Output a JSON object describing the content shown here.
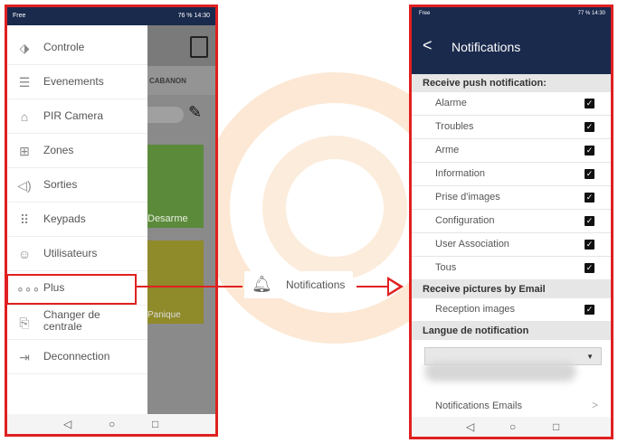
{
  "left": {
    "status": {
      "left": "Free",
      "right": "76 % 14:30"
    },
    "bg": {
      "tab": "CABANON",
      "green_label": "Desarme",
      "yellow_label": "Panique"
    },
    "menu": [
      {
        "name": "controle",
        "label": "Controle",
        "icon": "⬗"
      },
      {
        "name": "evenements",
        "label": "Evenements",
        "icon": "☰"
      },
      {
        "name": "pir-camera",
        "label": "PIR Camera",
        "icon": "⌂"
      },
      {
        "name": "zones",
        "label": "Zones",
        "icon": "⊞"
      },
      {
        "name": "sorties",
        "label": "Sorties",
        "icon": "◁)"
      },
      {
        "name": "keypads",
        "label": "Keypads",
        "icon": "⠿"
      },
      {
        "name": "utilisateurs",
        "label": "Utilisateurs",
        "icon": "☺"
      },
      {
        "name": "plus",
        "label": "Plus",
        "icon": "∘∘∘"
      },
      {
        "name": "changer-de-centrale",
        "label": "Changer de\ncentrale",
        "icon": "⎘"
      },
      {
        "name": "deconnection",
        "label": "Deconnection",
        "icon": "⇥"
      }
    ]
  },
  "connector": {
    "label": "Notifications",
    "icon": "bell-icon"
  },
  "right": {
    "status": {
      "left": "Free",
      "right": "77 % 14:30"
    },
    "title": "Notifications",
    "push_header": "Receive push notification:",
    "push_items": [
      "Alarme",
      "Troubles",
      "Arme",
      "Information",
      "Prise d'images",
      "Configuration",
      "User Association",
      "Tous"
    ],
    "email_header": "Receive pictures by Email",
    "email_items": [
      "Reception images"
    ],
    "lang_header": "Langue de notification",
    "emails_link": "Notifications Emails"
  },
  "colors": {
    "accent": "#e02020",
    "navy": "#1a2a4d"
  }
}
